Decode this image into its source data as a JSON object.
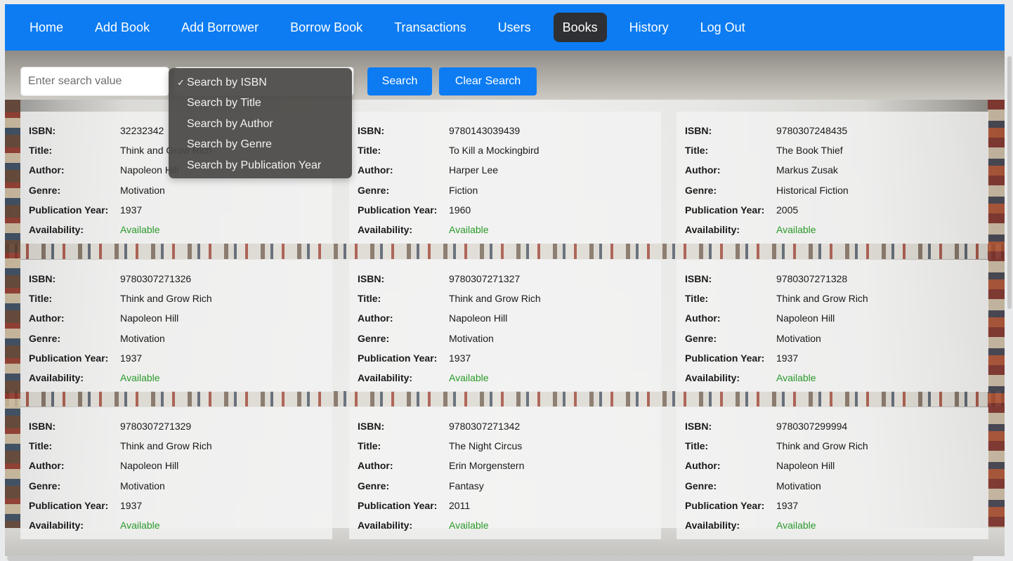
{
  "nav": {
    "items": [
      {
        "label": "Home",
        "active": false
      },
      {
        "label": "Add Book",
        "active": false
      },
      {
        "label": "Add Borrower",
        "active": false
      },
      {
        "label": "Borrow Book",
        "active": false
      },
      {
        "label": "Transactions",
        "active": false
      },
      {
        "label": "Users",
        "active": false
      },
      {
        "label": "Books",
        "active": true
      },
      {
        "label": "History",
        "active": false
      },
      {
        "label": "Log Out",
        "active": false
      }
    ],
    "bar_color": "#0d7cf2",
    "active_color": "#2f3033"
  },
  "search": {
    "placeholder": "Enter search value",
    "value": "",
    "search_label": "Search",
    "clear_label": "Clear Search",
    "dropdown": {
      "selected": "Search by ISBN",
      "check_glyph": "✓",
      "options": [
        "Search by ISBN",
        "Search by Title",
        "Search by Author",
        "Search by Genre",
        "Search by Publication Year"
      ]
    }
  },
  "labels": {
    "isbn": "ISBN:",
    "title": "Title:",
    "author": "Author:",
    "genre": "Genre:",
    "year": "Publication Year:",
    "availability": "Availability:"
  },
  "books": [
    {
      "isbn": "32232342",
      "title": "Think and Grow Rich",
      "author": "Napoleon Hill",
      "genre": "Motivation",
      "year": "1937",
      "availability": "Available"
    },
    {
      "isbn": "9780143039439",
      "title": "To Kill a Mockingbird",
      "author": "Harper Lee",
      "genre": "Fiction",
      "year": "1960",
      "availability": "Available"
    },
    {
      "isbn": "9780307248435",
      "title": "The Book Thief",
      "author": "Markus Zusak",
      "genre": "Historical Fiction",
      "year": "2005",
      "availability": "Available"
    },
    {
      "isbn": "9780307271326",
      "title": "Think and Grow Rich",
      "author": "Napoleon Hill",
      "genre": "Motivation",
      "year": "1937",
      "availability": "Available"
    },
    {
      "isbn": "9780307271327",
      "title": "Think and Grow Rich",
      "author": "Napoleon Hill",
      "genre": "Motivation",
      "year": "1937",
      "availability": "Available"
    },
    {
      "isbn": "9780307271328",
      "title": "Think and Grow Rich",
      "author": "Napoleon Hill",
      "genre": "Motivation",
      "year": "1937",
      "availability": "Available"
    },
    {
      "isbn": "9780307271329",
      "title": "Think and Grow Rich",
      "author": "Napoleon Hill",
      "genre": "Motivation",
      "year": "1937",
      "availability": "Available"
    },
    {
      "isbn": "9780307271342",
      "title": "The Night Circus",
      "author": "Erin Morgenstern",
      "genre": "Fantasy",
      "year": "2011",
      "availability": "Available"
    },
    {
      "isbn": "9780307299994",
      "title": "Think and Grow Rich",
      "author": "Napoleon Hill",
      "genre": "Motivation",
      "year": "1937",
      "availability": "Available"
    }
  ],
  "colors": {
    "available": "#2a9a2a",
    "button": "#0d7cf2"
  }
}
